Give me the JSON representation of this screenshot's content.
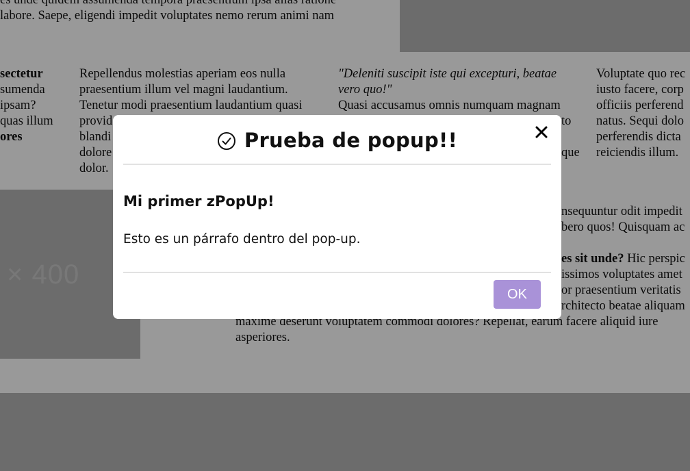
{
  "background": {
    "top_text_line1": "es unde quidem assumenda tempora praesentium ipsa alias ratione",
    "top_text_line2": "labore. Saepe, eligendi impedit voluptates nemo rerum animi nam",
    "col1": {
      "bold_1": "sectetur",
      "line2": "sumenda",
      "line3": "ipsam?",
      "line4": "quas illum",
      "bold_2": "ores"
    },
    "col2": {
      "line1": "Repellendus molestias aperiam eos nulla",
      "line2": "praesentium illum vel magni laudantium.",
      "line3": "Tenetur modi praesentium laudantium quasi",
      "line4": "provid",
      "line5": "blandi",
      "line6": "dolore",
      "line7": "dolor."
    },
    "col3": {
      "italic_1": "\"Deleniti suscipit iste qui excepturi, beatae",
      "italic_2": "vero quo!\"",
      "line3": "Quasi accusamus omnis numquam magnam",
      "frag4": "to",
      "frag6": "que"
    },
    "col4": {
      "line1": "Voluptate quo rec",
      "line2": "iusto facere, corp",
      "line3": "officiis perferend",
      "line4": "natus. Sequi dolo",
      "line5": "perferendis dicta",
      "line6": "reiciendis illum."
    },
    "placeholder_text": "× 400",
    "lower": {
      "line1": "nsequuntur odit impedit",
      "line2": "bero quos! Quisquam ac",
      "line3_bold": "es sit unde?",
      "line3_rest": " Hic perspic",
      "line4": "issimos voluptates amet",
      "line5": "or praesentium veritatis",
      "line6": "rchitecto beatae aliquam",
      "line7": "maxime deserunt voluptatem commodi dolores? Repellat, earum facere aliquid iure",
      "line8": "asperiores."
    }
  },
  "popup": {
    "title": "Prueba de popup!!",
    "title_icon": "check-circle-icon",
    "close_icon": "close-icon",
    "subtitle": "Mi primer zPopUp!",
    "paragraph": "Esto es un párrafo dentro del pop-up.",
    "ok_label": "OK",
    "ok_color": "#a992d8"
  },
  "colors": {
    "overlay": "rgba(0,0,0,0.40)",
    "placeholder_gray": "#b4b4b4"
  }
}
